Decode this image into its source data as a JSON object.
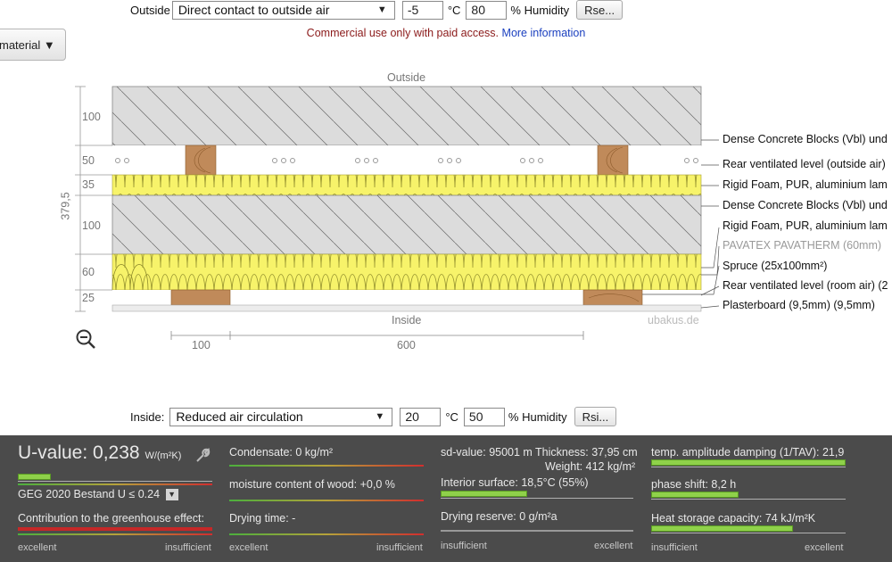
{
  "top": {
    "outside_label": "Outside",
    "outside_select": "Direct contact to outside air",
    "outside_temp": "-5",
    "outside_temp_unit": "°C",
    "outside_humidity": "80",
    "humidity_unit": "% Humidity",
    "rse_button": "Rse...",
    "material_button": "material ▼",
    "notice_text": "Commercial use only with paid access.",
    "notice_link": "More information"
  },
  "diagram": {
    "outside_caption": "Outside",
    "inside_caption": "Inside",
    "watermark": "ubakus.de",
    "total_thickness": "379,5",
    "layer_thicknesses": [
      "100",
      "50",
      "35",
      "100",
      "60",
      "25"
    ],
    "bottom_dims": [
      "100",
      "600"
    ],
    "layers": [
      {
        "label": "Dense Concrete Blocks (Vbl) und",
        "faded": false
      },
      {
        "label": "Rear ventilated level (outside air)",
        "faded": false
      },
      {
        "label": "Rigid Foam, PUR, aluminium lam",
        "faded": false
      },
      {
        "label": "Dense Concrete Blocks (Vbl) und",
        "faded": false
      },
      {
        "label": "Rigid Foam, PUR, aluminium lam",
        "faded": false
      },
      {
        "label": "PAVATEX PAVATHERM (60mm)",
        "faded": true
      },
      {
        "label": "Spruce (25x100mm²)",
        "faded": false
      },
      {
        "label": "Rear ventilated level (room air) (2",
        "faded": false
      },
      {
        "label": "Plasterboard (9,5mm) (9,5mm)",
        "faded": false
      }
    ]
  },
  "inside": {
    "label": "Inside:",
    "select": "Reduced air circulation",
    "temp": "20",
    "temp_unit": "°C",
    "humidity": "50",
    "humidity_unit": "% Humidity",
    "rsi_button": "Rsi..."
  },
  "results": {
    "u_label": "U-value:",
    "u_value": "0,238",
    "u_unit": "W/(m²K)",
    "u_fill": 0.17,
    "standard": "GEG 2020 Bestand U ≤ 0.24",
    "greenhouse": "Contribution to the greenhouse effect:",
    "condensate": "Condensate: 0 kg/m²",
    "moisture": "moisture content of wood: +0,0 %",
    "drying_time": "Drying time: -",
    "sd_value": "sd-value: 95001 m",
    "thickness": "Thickness: 37,95 cm",
    "weight": "Weight: 412 kg/m²",
    "interior_surface": "Interior surface: 18,5°C (55%)",
    "interior_fill": 0.45,
    "drying_reserve": "Drying reserve: 0 g/m²a",
    "tav": "temp. amplitude damping (1/TAV): 21,9",
    "tav_fill": 1.0,
    "phase_shift": "phase shift: 8,2 h",
    "phase_fill": 0.45,
    "heat_storage": "Heat storage capacity: 74 kJ/m²K",
    "heat_fill": 0.73,
    "scale_excellent": "excellent",
    "scale_insufficient": "insufficient"
  },
  "colors": {
    "insulation": "#f7f36a",
    "wood": "#c08a5a",
    "concrete": "#dcdcdc",
    "panel": "#4b4b4b",
    "bar_green": "#8fd14a"
  }
}
